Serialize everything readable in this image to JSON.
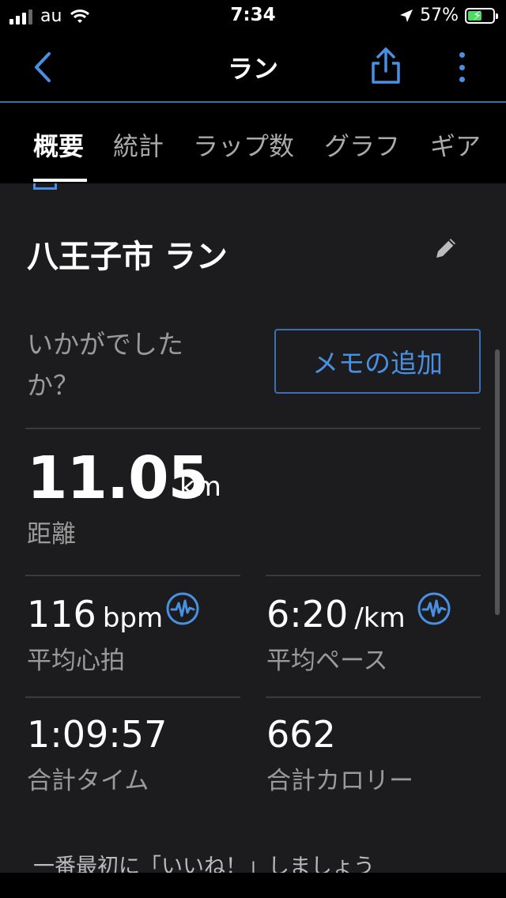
{
  "status_bar": {
    "carrier": "au",
    "time": "7:34",
    "battery_percent": "57%",
    "battery_level": 0.57,
    "icons": [
      "signal-icon",
      "wifi-icon",
      "location-arrow-icon",
      "battery-charging-icon"
    ]
  },
  "nav": {
    "title": "ラン",
    "icons": [
      "back-chevron-icon",
      "share-icon",
      "more-vertical-icon"
    ],
    "accent_color": "#4a90e2"
  },
  "tabs": [
    {
      "label": "概要",
      "active": true
    },
    {
      "label": "統計",
      "active": false
    },
    {
      "label": "ラップ数",
      "active": false
    },
    {
      "label": "グラフ",
      "active": false
    },
    {
      "label": "ギア",
      "active": false
    }
  ],
  "activity": {
    "name": "八王子市 ラン",
    "feel_question": "いかがでしたか？",
    "memo_button": "メモの追加"
  },
  "distance": {
    "value": "11.05",
    "unit": "km",
    "label": "距離"
  },
  "stats": [
    {
      "value": "116",
      "unit": "bpm",
      "label": "平均心拍",
      "icon": "heart-rate-icon"
    },
    {
      "value": "6:20",
      "unit": "/km",
      "label": "平均ペース",
      "icon": "heart-rate-icon"
    },
    {
      "value": "1:09:57",
      "unit": "",
      "label": "合計タイム"
    },
    {
      "value": "662",
      "unit": "",
      "label": "合計カロリー"
    }
  ],
  "like_prompt": "一番最初に「いいね！」しましょう"
}
